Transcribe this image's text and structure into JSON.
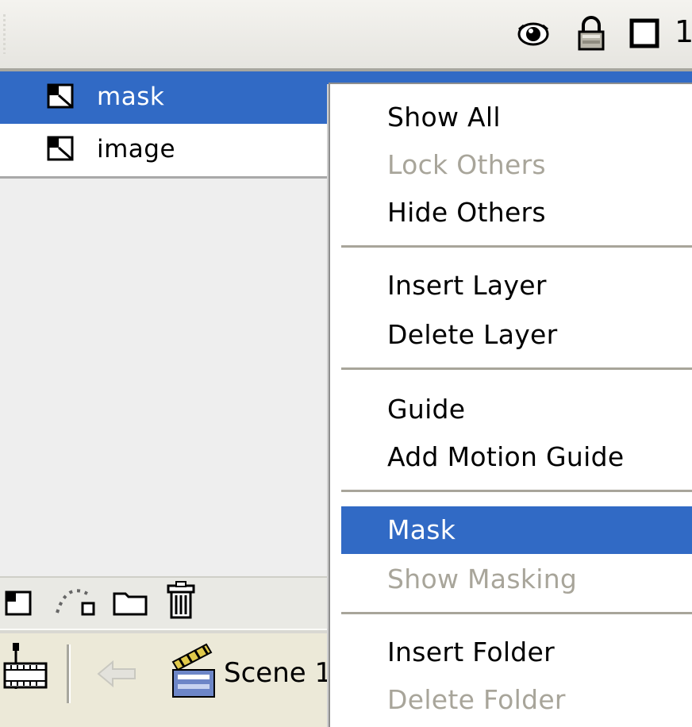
{
  "timeline_header": {
    "icons": [
      "eye-icon",
      "lock-icon",
      "outline-square-icon"
    ],
    "frame_number_partial": "1"
  },
  "layers": [
    {
      "name": "mask",
      "selected": true,
      "icon": "layer-icon"
    },
    {
      "name": "image",
      "selected": false,
      "icon": "layer-icon"
    }
  ],
  "layer_tools": [
    "insert-layer-icon",
    "add-motion-guide-icon",
    "insert-folder-icon",
    "delete-layer-icon"
  ],
  "scene_bar": {
    "edit_icon": "timeline-edit-icon",
    "back_icon": "back-arrow-icon",
    "scene_icon": "clapperboard-icon",
    "scene_label": "Scene 1"
  },
  "context_menu": {
    "items": [
      {
        "label": "Show All",
        "state": "enabled"
      },
      {
        "label": "Lock Others",
        "state": "disabled"
      },
      {
        "label": "Hide Others",
        "state": "enabled"
      },
      {
        "separator": true
      },
      {
        "label": "Insert Layer",
        "state": "enabled"
      },
      {
        "label": "Delete Layer",
        "state": "enabled"
      },
      {
        "separator": true
      },
      {
        "label": "Guide",
        "state": "enabled"
      },
      {
        "label": "Add Motion Guide",
        "state": "enabled"
      },
      {
        "separator": true
      },
      {
        "label": "Mask",
        "state": "highlighted"
      },
      {
        "label": "Show Masking",
        "state": "disabled"
      },
      {
        "separator": true
      },
      {
        "label": "Insert Folder",
        "state": "enabled"
      },
      {
        "label": "Delete Folder",
        "state": "disabled"
      }
    ]
  },
  "colors": {
    "selection_blue": "#316ac5",
    "disabled_text": "#a8a59a",
    "panel_bg": "#eeeeee"
  }
}
